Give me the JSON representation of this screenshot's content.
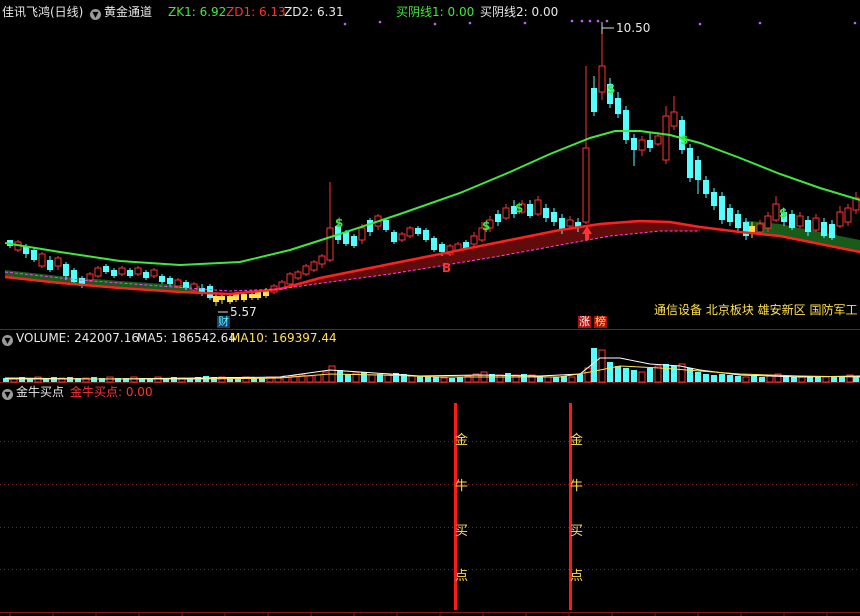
{
  "header": {
    "stock_name": "佳讯飞鸿(日线)",
    "indicator_name": "黄金通道",
    "zk1": "ZK1: 6.92",
    "zd1": "ZD1: 6.13",
    "zd2": "ZD2: 6.31",
    "buy_line1": "买阴线1: 0.00",
    "buy_line2": "买阴线2: 0.00"
  },
  "price_panel": {
    "high_label": "10.50",
    "low_label": "5.57",
    "low_marker": "财",
    "b_marker": "B",
    "zhang_badge": "涨",
    "bang_badge": "榜",
    "dollar": "$",
    "concepts": "通信设备 北京板块 雄安新区 国防军工"
  },
  "volume_panel": {
    "volume": "VOLUME: 242007.16",
    "ma5": "MA5: 186542.64",
    "ma10": "MA10: 169397.44"
  },
  "signal_panel": {
    "title": "金牛买点",
    "value_label": "金牛买点: 0.00",
    "chars": [
      "金",
      "牛",
      "买",
      "点"
    ]
  },
  "colors": {
    "up": "#ff3333",
    "down": "#54ffff",
    "green_line": "#3fe83f",
    "red_line": "#ff2020",
    "magenta_line": "#ff40ff",
    "gold": "#ffe14d",
    "header_green": "#3fe83f",
    "header_red": "#ff3333"
  }
}
